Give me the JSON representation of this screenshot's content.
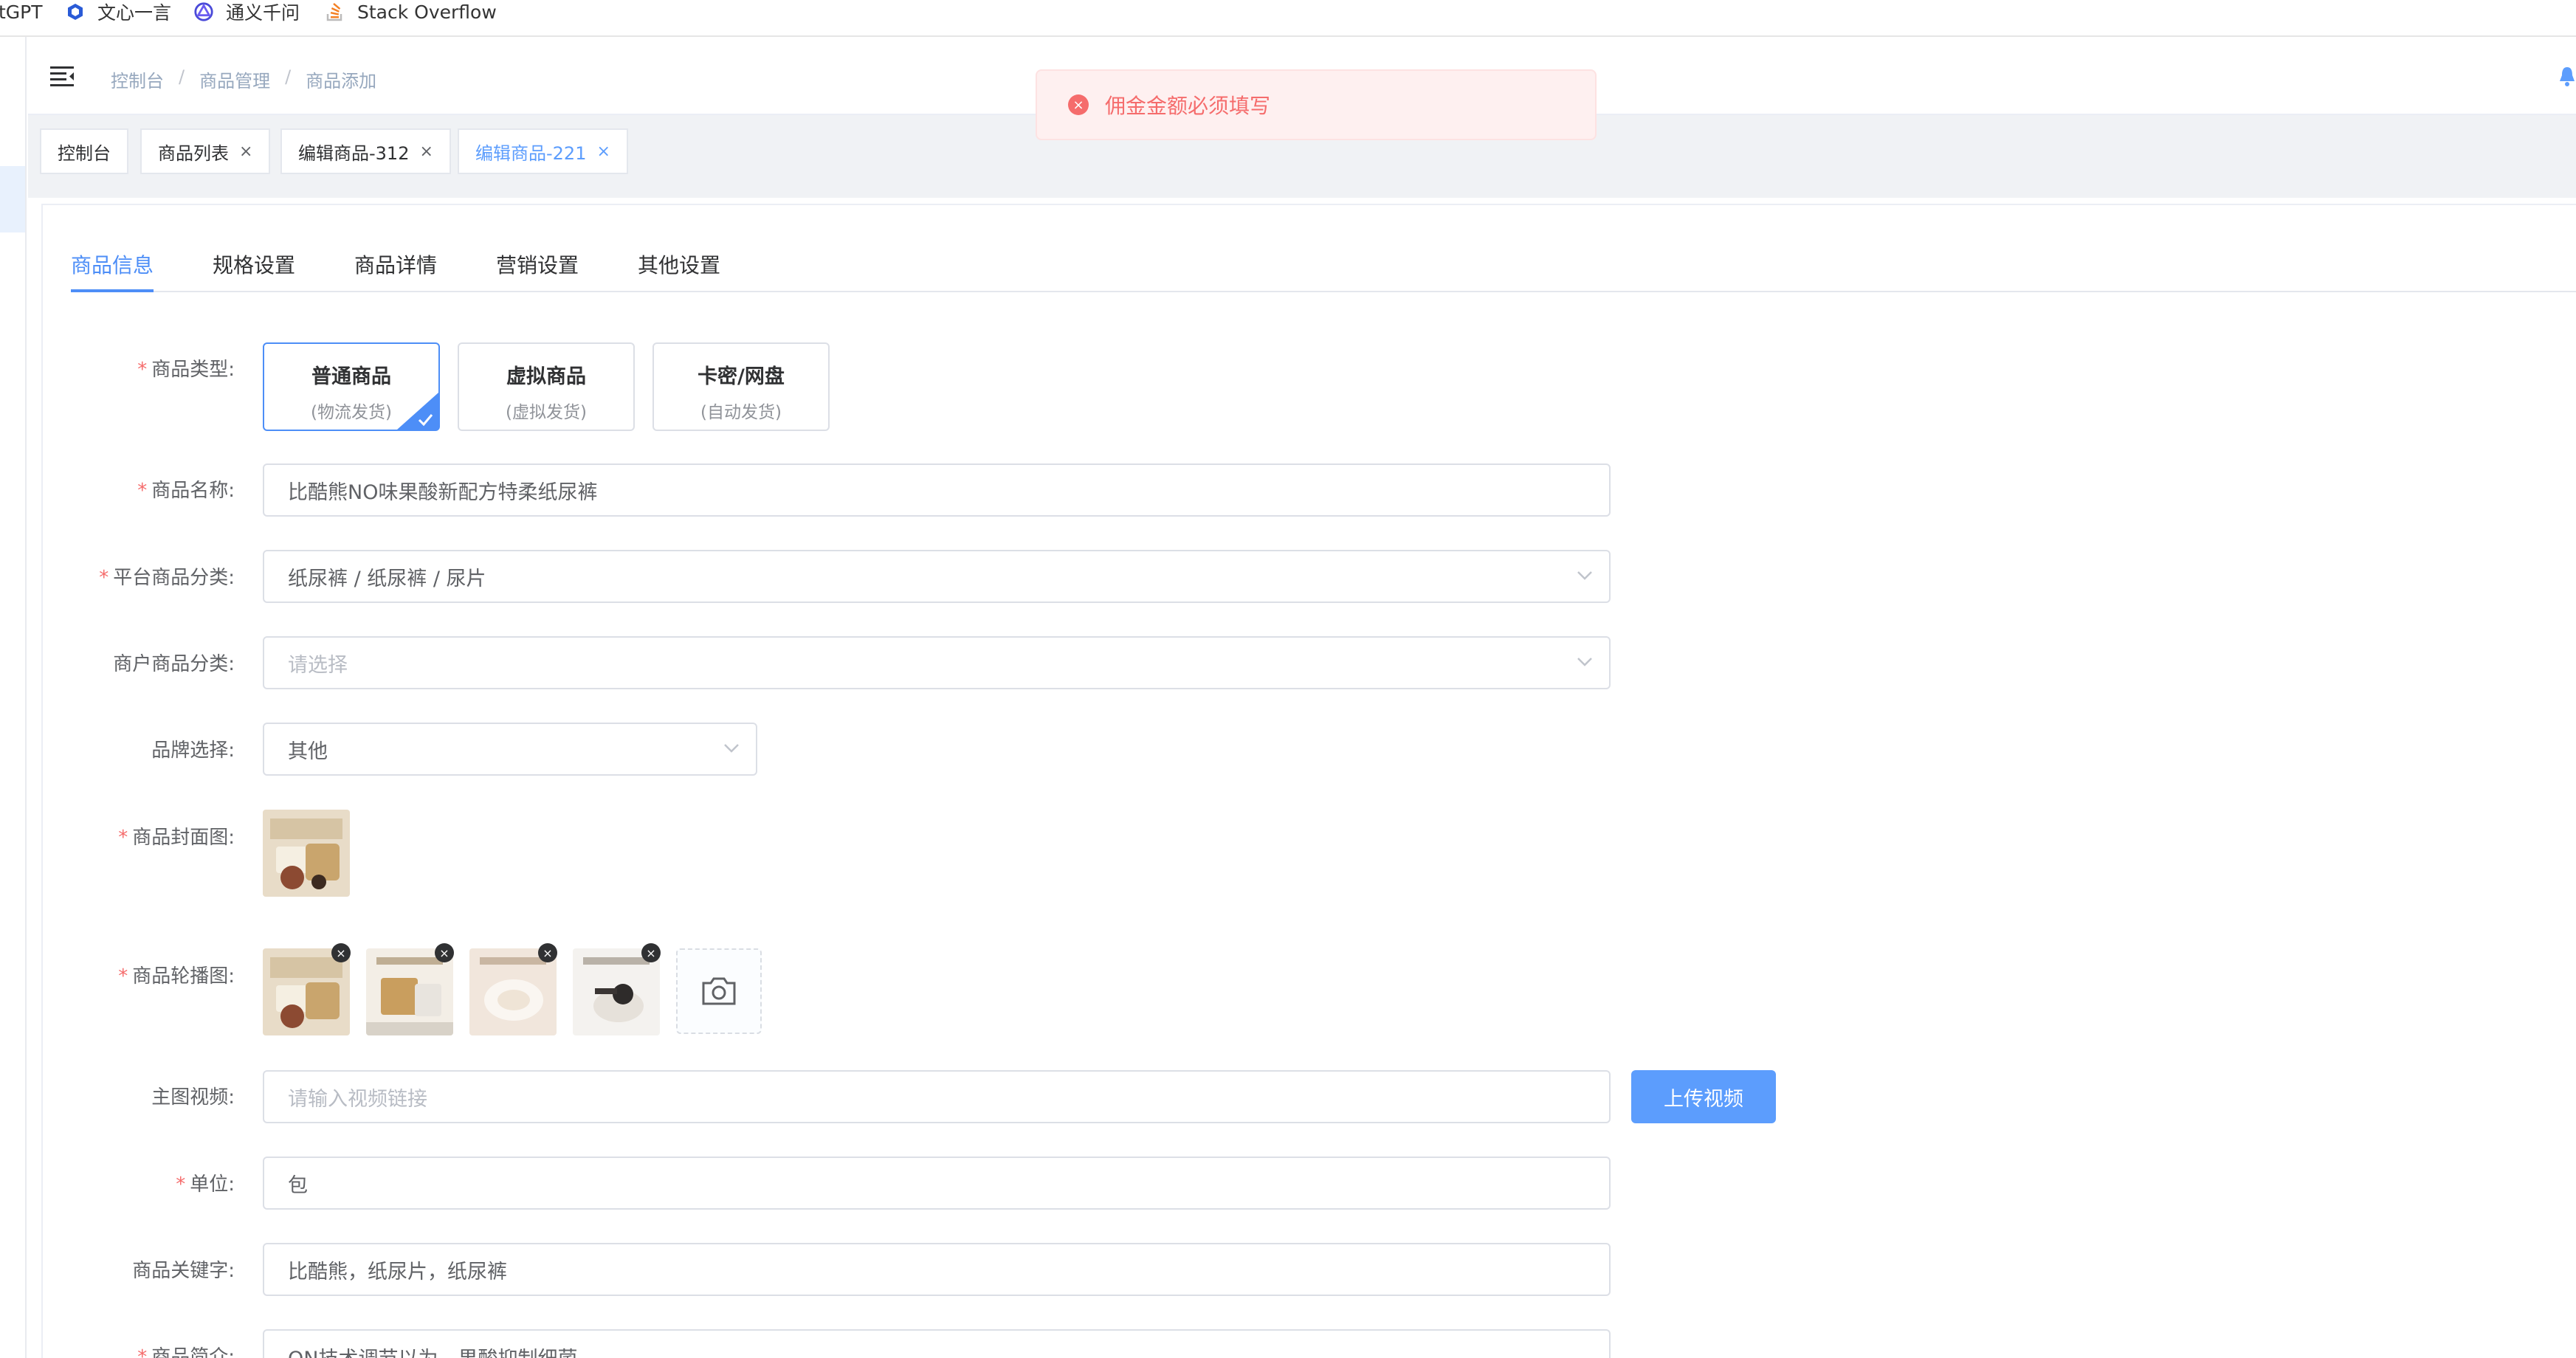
{
  "bookmarks": [
    {
      "label": "tGPT",
      "icon": "chatgpt-icon"
    },
    {
      "label": "文心一言",
      "icon": "wenxin-icon"
    },
    {
      "label": "通义千问",
      "icon": "tongyi-icon"
    },
    {
      "label": "Stack Overflow",
      "icon": "stackoverflow-icon"
    }
  ],
  "breadcrumb": [
    "控制台",
    "商品管理",
    "商品添加"
  ],
  "breadcrumb_sep": "/",
  "tags": [
    {
      "label": "控制台",
      "closable": false,
      "active": false
    },
    {
      "label": "商品列表",
      "closable": true,
      "active": false
    },
    {
      "label": "编辑商品-312",
      "closable": true,
      "active": false
    },
    {
      "label": "编辑商品-221",
      "closable": true,
      "active": true
    }
  ],
  "tag_close": "×",
  "tabs": [
    "商品信息",
    "规格设置",
    "商品详情",
    "营销设置",
    "其他设置"
  ],
  "active_tab": 0,
  "toast": {
    "message": "佣金金额必须填写",
    "type": "error",
    "icon": "×"
  },
  "form": {
    "type_label": "商品类型:",
    "types": [
      {
        "title": "普通商品",
        "sub": "(物流发货)",
        "selected": true
      },
      {
        "title": "虚拟商品",
        "sub": "(虚拟发货)",
        "selected": false
      },
      {
        "title": "卡密/网盘",
        "sub": "(自动发货)",
        "selected": false
      }
    ],
    "name_label": "商品名称:",
    "name_value": "比酷熊NO味果酸新配方特柔纸尿裤",
    "platform_cat_label": "平台商品分类:",
    "platform_cat_value": "纸尿裤 / 纸尿裤 / 尿片",
    "merchant_cat_label": "商户商品分类:",
    "merchant_cat_placeholder": "请选择",
    "brand_label": "品牌选择:",
    "brand_value": "其他",
    "cover_label": "商品封面图:",
    "carousel_label": "商品轮播图:",
    "video_label": "主图视频:",
    "video_placeholder": "请输入视频链接",
    "upload_video": "上传视频",
    "unit_label": "单位:",
    "unit_value": "包",
    "keyword_label": "商品关键字:",
    "keyword_value": "比酷熊，纸尿片，纸尿裤",
    "intro_label": "商品简介:",
    "intro_value": "ON技术调节以为，果酸抑制细菌",
    "thumb_remove": "×"
  },
  "colors": {
    "primary": "#4d8ef7",
    "danger": "#f56c6c",
    "required": "#f56c6c"
  }
}
